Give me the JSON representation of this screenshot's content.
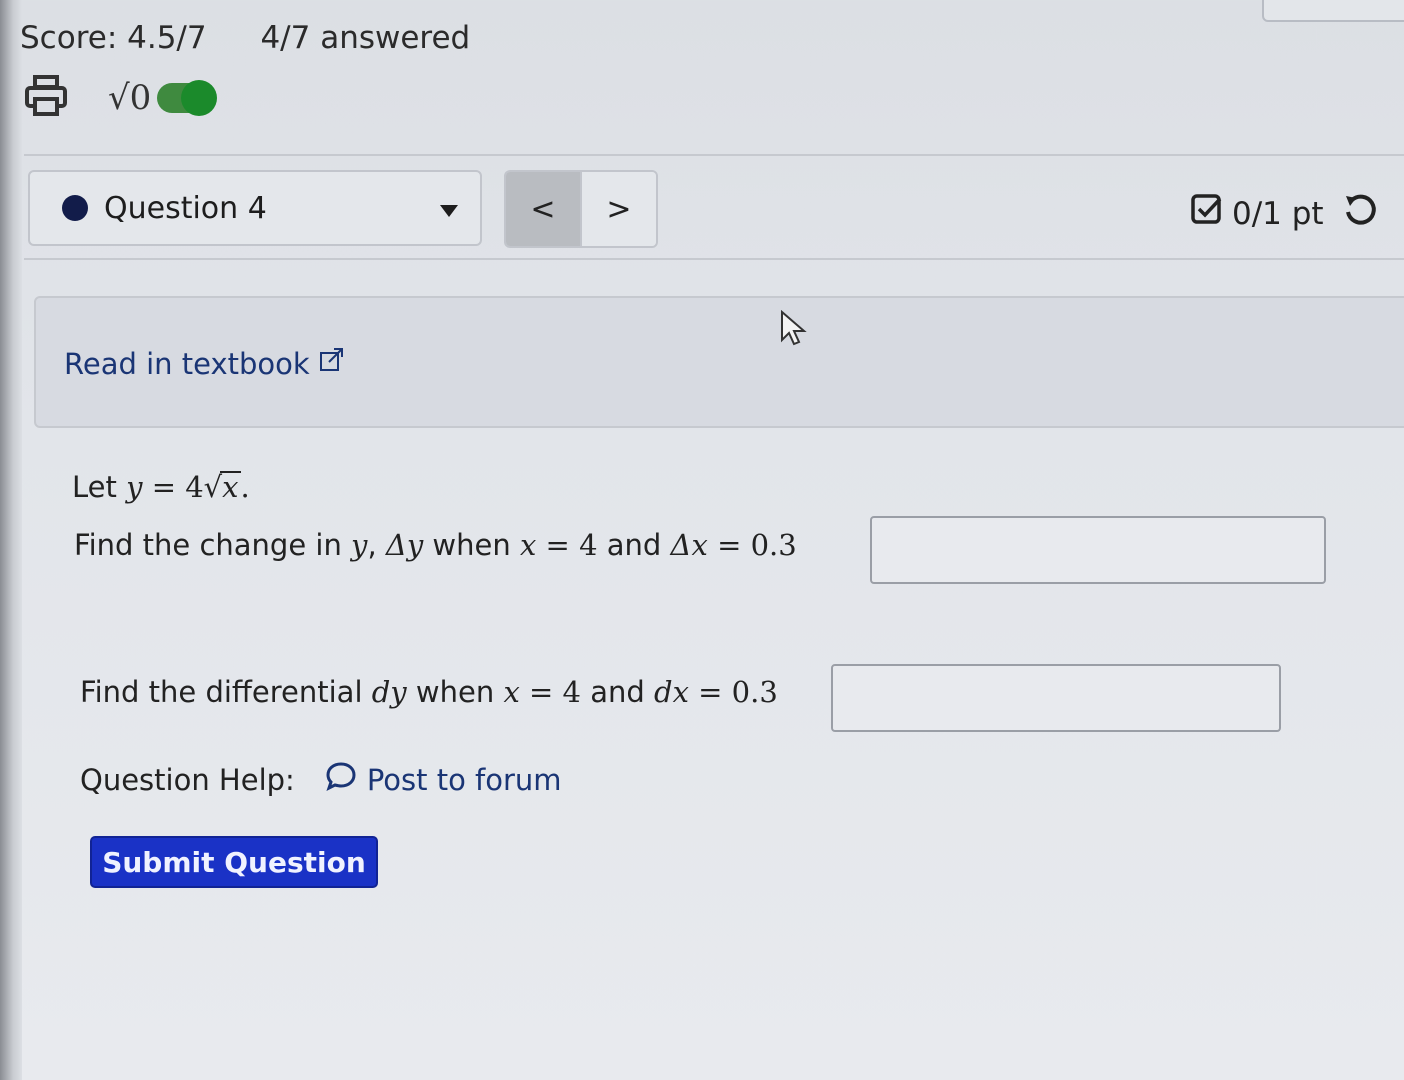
{
  "header": {
    "score": "Score: 4.5/7",
    "answered": "4/7 answered"
  },
  "tools": {
    "print_icon": "printer-icon",
    "math_toggle_label": "√0",
    "math_toggle_on": true
  },
  "question_nav": {
    "selected": "Question 4",
    "prev_label": "<",
    "next_label": ">"
  },
  "points": {
    "label": "0/1 pt"
  },
  "textbook": {
    "link_label": "Read in textbook"
  },
  "problem": {
    "given": {
      "prefix": "Let",
      "var": "y",
      "eq": "=",
      "coef": "4",
      "radicand": "x",
      "end": "."
    },
    "part1": {
      "t1": "Find the change in",
      "v_y": "y",
      "comma": ",",
      "delta_y": "Δy",
      "t2": "when",
      "v_x": "x",
      "eq1": "=",
      "x_val": "4",
      "t3": "and",
      "delta_x": "Δx",
      "eq2": "=",
      "dx_val": "0.3",
      "answer_value": ""
    },
    "part2": {
      "t1": "Find the differential",
      "dy": "dy",
      "t2": "when",
      "v_x": "x",
      "eq1": "=",
      "x_val": "4",
      "t3": "and",
      "dx": "dx",
      "eq2": "=",
      "dx_val": "0.3",
      "answer_value": ""
    }
  },
  "help": {
    "label": "Question Help:",
    "forum_label": "Post to forum"
  },
  "submit": {
    "label": "Submit Question"
  },
  "colors": {
    "submit_bg": "#1a32c6",
    "link": "#1a3575",
    "toggle_on": "#1b8a2b",
    "question_dot": "#121c4a"
  }
}
